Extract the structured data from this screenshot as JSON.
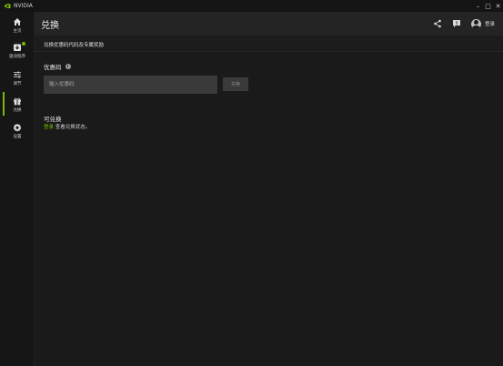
{
  "window": {
    "title": "NVIDIA",
    "controls": {
      "minimize": "–",
      "maximize": "□",
      "close": "✕"
    }
  },
  "sidebar": {
    "items": [
      {
        "label": "主页",
        "icon": "home-icon"
      },
      {
        "label": "驱动程序",
        "icon": "driver-icon"
      },
      {
        "label": "调节",
        "icon": "sliders-icon"
      },
      {
        "label": "兑换",
        "icon": "gift-icon",
        "active": true
      },
      {
        "label": "设置",
        "icon": "gear-icon"
      }
    ]
  },
  "header": {
    "title": "兑换",
    "login_label": "登录"
  },
  "subheader": {
    "text": "兑换优惠码代码及专属奖励"
  },
  "promo": {
    "title": "优惠码",
    "info": "i",
    "placeholder": "输入优惠码",
    "redeem_label": "兑换"
  },
  "available": {
    "title": "可兑换",
    "login_link": "登录",
    "hint": " 查看兑换状态。"
  },
  "colors": {
    "accent": "#76b900",
    "background": "#1a1a1a",
    "header": "#242424"
  }
}
